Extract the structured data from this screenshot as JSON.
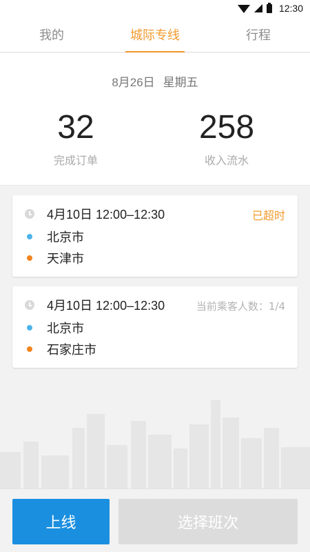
{
  "status_bar": {
    "time": "12:30"
  },
  "tabs": [
    {
      "label": "我的",
      "active": false
    },
    {
      "label": "城际专线",
      "active": true
    },
    {
      "label": "行程",
      "active": false
    }
  ],
  "summary": {
    "date": "8月26日",
    "weekday": "星期五",
    "orders": {
      "value": "32",
      "label": "完成订单"
    },
    "income": {
      "value": "258",
      "label": "收入流水"
    }
  },
  "trips": [
    {
      "time": "4月10日 12:00–12:30",
      "from": "北京市",
      "to": "天津市",
      "status": "已超时"
    },
    {
      "time": "4月10日 12:00–12:30",
      "from": "北京市",
      "to": "石家庄市",
      "passengers": "当前乘客人数：1/4"
    }
  ],
  "bottom": {
    "online_label": "上线",
    "select_label": "选择班次"
  },
  "colors": {
    "accent": "#f29a2e",
    "primary_button": "#1a8fe0",
    "disabled_button": "#dcdcdc",
    "origin_dot": "#4cb4ec",
    "destination_dot": "#f2841f"
  },
  "icons": [
    "wifi-icon",
    "signal-icon",
    "battery-icon",
    "clock-icon",
    "origin-dot-icon",
    "destination-dot-icon"
  ]
}
